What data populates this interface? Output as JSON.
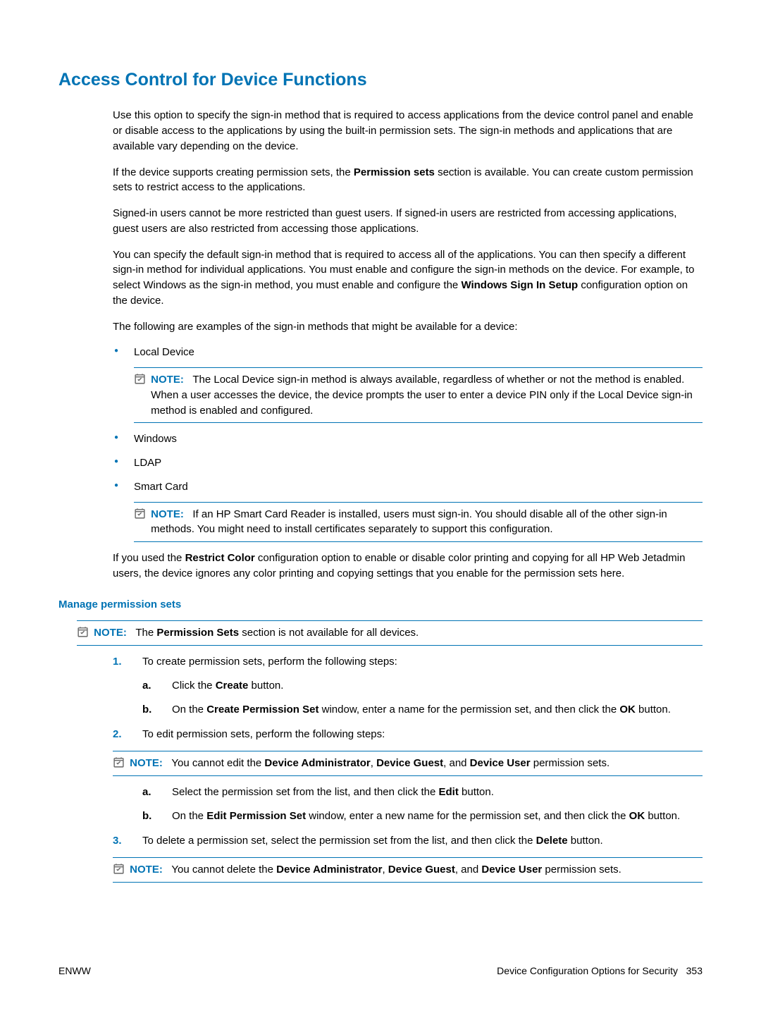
{
  "heading": "Access Control for Device Functions",
  "paras": {
    "intro1": "Use this option to specify the sign-in method that is required to access applications from the device control panel and enable or disable access to the applications by using the built-in permission sets. The sign-in methods and applications that are available vary depending on the device.",
    "intro2_pre": "If the device supports creating permission sets, the ",
    "intro2_bold": "Permission sets",
    "intro2_post": " section is available. You can create custom permission sets to restrict access to the applications.",
    "intro3": "Signed-in users cannot be more restricted than guest users. If signed-in users are restricted from accessing applications, guest users are also restricted from accessing those applications.",
    "intro4_pre": "You can specify the default sign-in method that is required to access all of the applications. You can then specify a different sign-in method for individual applications. You must enable and configure the sign-in methods on the device. For example, to select Windows as the sign-in method, you must enable and configure the ",
    "intro4_bold": "Windows Sign In Setup",
    "intro4_post": " configuration option on the device.",
    "intro5": "The following are examples of the sign-in methods that might be available for a device:",
    "bullets": {
      "local": "Local Device",
      "local_note": "The Local Device sign-in method is always available, regardless of whether or not the method is enabled. When a user accesses the device, the device prompts the user to enter a device PIN only if the Local Device sign-in method is enabled and configured.",
      "windows": "Windows",
      "ldap": "LDAP",
      "smart": "Smart Card",
      "smart_note": "If an HP Smart Card Reader is installed, users must sign-in. You should disable all of the other sign-in methods. You might need to install certificates separately to support this configuration."
    },
    "restrict_pre": "If you used the ",
    "restrict_bold": "Restrict Color",
    "restrict_post": " configuration option to enable or disable color printing and copying for all HP Web Jetadmin users, the device ignores any color printing and copying settings that you enable for the permission sets here."
  },
  "subsection": {
    "heading": "Manage permission sets",
    "note1_pre": "The ",
    "note1_bold": "Permission Sets",
    "note1_post": " section is not available for all devices.",
    "step1_text": "To create permission sets, perform the following steps:",
    "step1a_pre": "Click the ",
    "step1a_bold": "Create",
    "step1a_post": " button.",
    "step1b_pre": "On the ",
    "step1b_bold1": "Create Permission Set",
    "step1b_mid": " window, enter a name for the permission set, and then click the ",
    "step1b_bold2": "OK",
    "step1b_post": " button.",
    "step2_text": "To edit permission sets, perform the following steps:",
    "step2_note_pre": "You cannot edit the ",
    "step2_note_b1": "Device Administrator",
    "step2_note_m1": ", ",
    "step2_note_b2": "Device Guest",
    "step2_note_m2": ", and ",
    "step2_note_b3": "Device User",
    "step2_note_post": " permission sets.",
    "step2a_pre": "Select the permission set from the list, and then click the ",
    "step2a_bold": "Edit",
    "step2a_post": " button.",
    "step2b_pre": "On the ",
    "step2b_bold1": "Edit Permission Set",
    "step2b_mid": " window, enter a new name for the permission set, and then click the ",
    "step2b_bold2": "OK",
    "step2b_post": " button.",
    "step3_pre": "To delete a permission set, select the permission set from the list, and then click the ",
    "step3_bold": "Delete",
    "step3_post": " button.",
    "step3_note_pre": "You cannot delete the ",
    "step3_note_b1": "Device Administrator",
    "step3_note_m1": ", ",
    "step3_note_b2": "Device Guest",
    "step3_note_m2": ", and ",
    "step3_note_b3": "Device User",
    "step3_note_post": " permission sets."
  },
  "note_label": "NOTE:",
  "footer": {
    "left": "ENWW",
    "right_text": "Device Configuration Options for Security",
    "right_page": "353"
  },
  "numbers": {
    "n1": "1.",
    "n2": "2.",
    "n3": "3."
  },
  "alphas": {
    "a": "a.",
    "b": "b."
  }
}
